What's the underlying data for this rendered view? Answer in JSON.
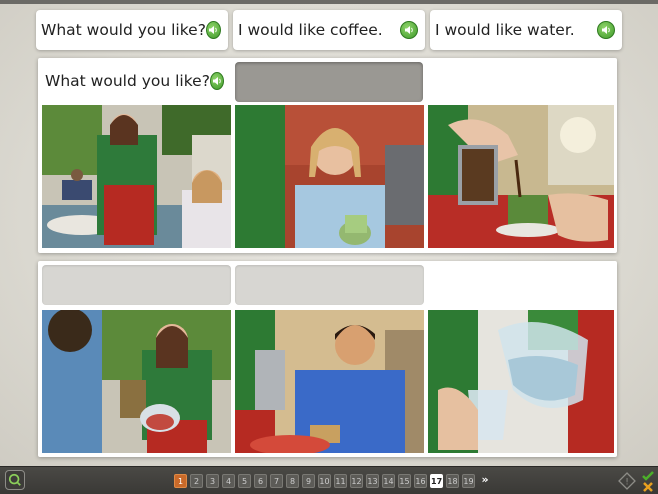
{
  "phrases": {
    "top_1": "What would you like?",
    "top_2": "I would like coffee.",
    "top_3": "I would like water.",
    "panel_prompt": "What would you like?"
  },
  "icons": {
    "audio": "speaker-icon",
    "logo": "app-logo-icon",
    "hint": "hint-icon",
    "check": "check-icon",
    "close": "close-icon",
    "next": "double-chevron-right-icon"
  },
  "pager": {
    "pages": [
      "1",
      "2",
      "3",
      "4",
      "5",
      "6",
      "7",
      "8",
      "9",
      "10",
      "11",
      "12",
      "13",
      "14",
      "15",
      "16",
      "17",
      "18",
      "19"
    ],
    "completed_page": "1",
    "current_page": "17",
    "next_label": "»"
  },
  "colors": {
    "accent_green": "#3f9a2a",
    "pager_done": "#c96a2a",
    "correct_check": "#4caf2a",
    "incorrect_x": "#e8a020"
  }
}
